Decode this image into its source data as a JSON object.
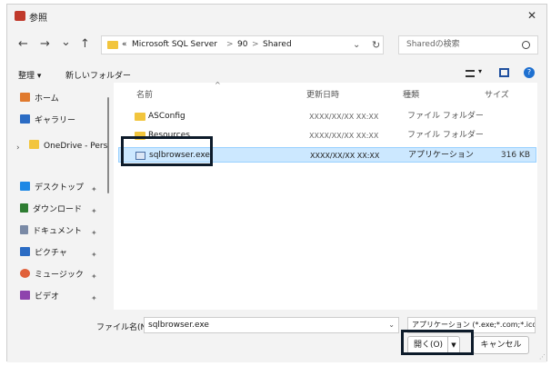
{
  "window": {
    "title": "参照",
    "close_glyph": "✕"
  },
  "nav": {
    "back": "←",
    "forward": "→",
    "recent": "⌄",
    "up": "↑",
    "refresh": "↻"
  },
  "address": {
    "prefix": "«",
    "parts": [
      "Microsoft SQL Server",
      "90",
      "Shared"
    ],
    "sep": ">"
  },
  "search": {
    "placeholder": "Sharedの検索"
  },
  "toolbar": {
    "organize": "整理 ▾",
    "new_folder": "新しいフォルダー"
  },
  "sidebar": {
    "items": [
      {
        "label": "ホーム",
        "icon": "home-icon",
        "color": "#e07a2e"
      },
      {
        "label": "ギャラリー",
        "icon": "gallery-icon",
        "color": "#2b6cc4"
      },
      {
        "label": "OneDrive - Pers",
        "icon": "folder-icon",
        "color": "#f2c53d"
      },
      {
        "label": "デスクトップ",
        "icon": "desktop-icon",
        "color": "#1e88e5"
      },
      {
        "label": "ダウンロード",
        "icon": "download-icon",
        "color": "#2e7d32"
      },
      {
        "label": "ドキュメント",
        "icon": "document-icon",
        "color": "#7a8aa6"
      },
      {
        "label": "ピクチャ",
        "icon": "pictures-icon",
        "color": "#2b6cc4"
      },
      {
        "label": "ミュージック",
        "icon": "music-icon",
        "color": "#e0603a"
      },
      {
        "label": "ビデオ",
        "icon": "video-icon",
        "color": "#8e44ad"
      }
    ]
  },
  "columns": {
    "name": "名前",
    "date": "更新日時",
    "type": "種類",
    "size": "サイズ"
  },
  "files": [
    {
      "name": "ASConfig",
      "date": "XXXX/XX/XX XX:XX",
      "type": "ファイル フォルダー",
      "size": "",
      "kind": "folder"
    },
    {
      "name": "Resources",
      "date": "XXXX/XX/XX XX:XX",
      "type": "ファイル フォルダー",
      "size": "",
      "kind": "folder"
    },
    {
      "name": "sqlbrowser.exe",
      "date": "XXXX/XX/XX XX:XX",
      "type": "アプリケーション",
      "size": "316 KB",
      "kind": "exe"
    }
  ],
  "bottom": {
    "filename_label": "ファイル名(N):",
    "filename_value": "sqlbrowser.exe",
    "filetype_value": "アプリケーション (*.exe;*.com;*.icd",
    "open_label": "開く(O)",
    "cancel_label": "キャンセル"
  },
  "colors": {
    "selected_row": "#cce8ff",
    "highlight_border": "#0d1b2a"
  }
}
